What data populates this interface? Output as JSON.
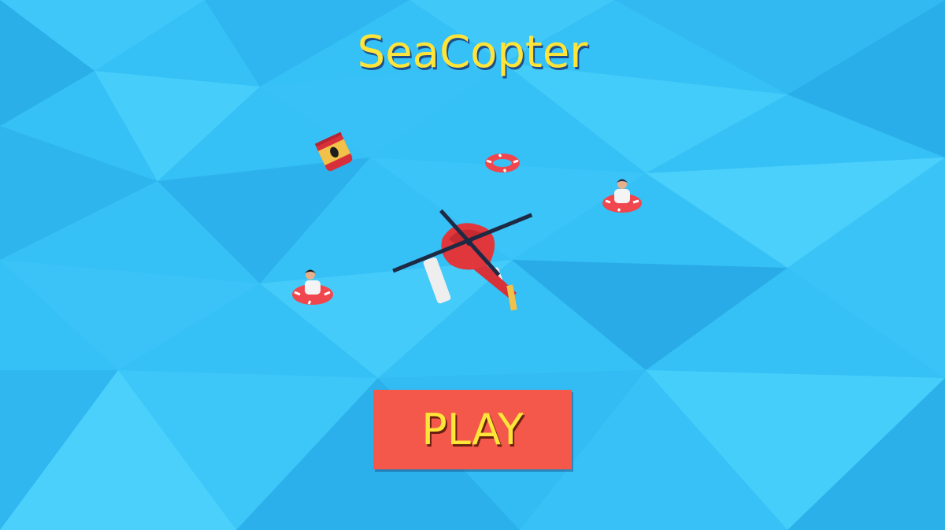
{
  "game": {
    "title": "SeaCopter"
  },
  "menu": {
    "play_label": "PLAY"
  },
  "scene_objects": [
    {
      "name": "helicopter",
      "description_icon": "helicopter-icon"
    },
    {
      "name": "fuel-barrel",
      "description_icon": "oil-barrel-icon"
    },
    {
      "name": "life-ring-empty",
      "description_icon": "life-ring-icon"
    },
    {
      "name": "survivor-right",
      "description_icon": "swimmer-icon"
    },
    {
      "name": "survivor-left",
      "description_icon": "swimmer-icon"
    }
  ],
  "colors": {
    "ocean": "#33bdf5",
    "title": "#ffe53a",
    "button": "#f4584a",
    "helicopter_body": "#e0373c"
  }
}
